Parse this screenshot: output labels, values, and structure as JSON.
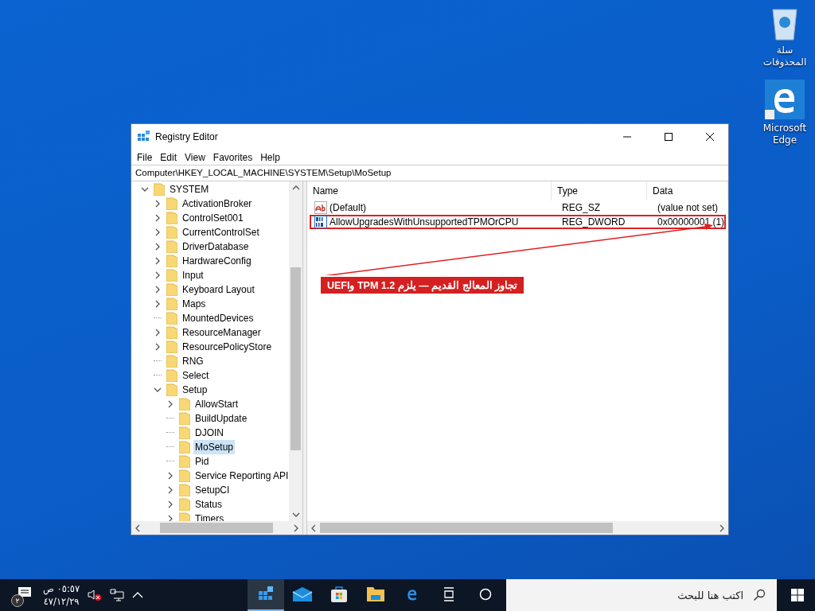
{
  "desktop_icons": [
    {
      "kind": "recycle",
      "label": "سلة المحذوفات"
    },
    {
      "kind": "edge",
      "label": "Microsoft Edge"
    }
  ],
  "window": {
    "title": "Registry Editor",
    "menu": [
      "File",
      "Edit",
      "View",
      "Favorites",
      "Help"
    ],
    "address": "Computer\\HKEY_LOCAL_MACHINE\\SYSTEM\\Setup\\MoSetup",
    "tree": [
      {
        "label": "SYSTEM",
        "kind": "branch",
        "expanded": true,
        "selected": false,
        "children": [
          {
            "label": "ActivationBroker",
            "kind": "branch",
            "expanded": false,
            "selected": false
          },
          {
            "label": "ControlSet001",
            "kind": "branch",
            "expanded": false,
            "selected": false
          },
          {
            "label": "CurrentControlSet",
            "kind": "branch",
            "expanded": false,
            "selected": false
          },
          {
            "label": "DriverDatabase",
            "kind": "branch",
            "expanded": false,
            "selected": false
          },
          {
            "label": "HardwareConfig",
            "kind": "branch",
            "expanded": false,
            "selected": false
          },
          {
            "label": "Input",
            "kind": "branch",
            "expanded": false,
            "selected": false
          },
          {
            "label": "Keyboard Layout",
            "kind": "branch",
            "expanded": false,
            "selected": false
          },
          {
            "label": "Maps",
            "kind": "branch",
            "expanded": false,
            "selected": false
          },
          {
            "label": "MountedDevices",
            "kind": "leaf",
            "selected": false
          },
          {
            "label": "ResourceManager",
            "kind": "branch",
            "expanded": false,
            "selected": false
          },
          {
            "label": "ResourcePolicyStore",
            "kind": "branch",
            "expanded": false,
            "selected": false
          },
          {
            "label": "RNG",
            "kind": "leaf",
            "selected": false
          },
          {
            "label": "Select",
            "kind": "leaf",
            "selected": false
          },
          {
            "label": "Setup",
            "kind": "branch",
            "expanded": true,
            "selected": false,
            "children": [
              {
                "label": "AllowStart",
                "kind": "branch",
                "expanded": false,
                "selected": false
              },
              {
                "label": "BuildUpdate",
                "kind": "leaf",
                "selected": false
              },
              {
                "label": "DJOIN",
                "kind": "leaf",
                "selected": false
              },
              {
                "label": "MoSetup",
                "kind": "leaf",
                "selected": true
              },
              {
                "label": "Pid",
                "kind": "leaf",
                "selected": false
              },
              {
                "label": "Service Reporting API",
                "kind": "branch",
                "expanded": false,
                "selected": false
              },
              {
                "label": "SetupCI",
                "kind": "branch",
                "expanded": false,
                "selected": false
              },
              {
                "label": "Status",
                "kind": "branch",
                "expanded": false,
                "selected": false
              },
              {
                "label": "Timers",
                "kind": "branch",
                "expanded": false,
                "selected": false
              }
            ]
          }
        ]
      }
    ],
    "table": {
      "columns": [
        "Name",
        "Type",
        "Data"
      ],
      "rows": [
        {
          "kind": "string",
          "name": "(Default)",
          "type": "REG_SZ",
          "data": "(value not set)",
          "highlighted": false
        },
        {
          "kind": "binary",
          "name": "AllowUpgradesWithUnsupportedTPMOrCPU",
          "type": "REG_DWORD",
          "data": "0x00000001 (1)",
          "highlighted": true
        }
      ]
    },
    "annotation": "تجاوز المعالج القديم — يلزم TPM 1.2 وUEFI"
  },
  "taskbar": {
    "notification_count": "٢",
    "time": "٠٥:٥٧ ص",
    "date": "٤٧/١٢/٢٩",
    "apps": [
      {
        "kind": "regedit",
        "selected": true
      },
      {
        "kind": "mail",
        "selected": false
      },
      {
        "kind": "store",
        "selected": false
      },
      {
        "kind": "explorer",
        "selected": false
      },
      {
        "kind": "edge",
        "selected": false
      },
      {
        "kind": "taskview",
        "selected": false
      },
      {
        "kind": "cortana",
        "selected": false
      }
    ],
    "search": {
      "placeholder": "اكتب هنا للبحث"
    }
  }
}
